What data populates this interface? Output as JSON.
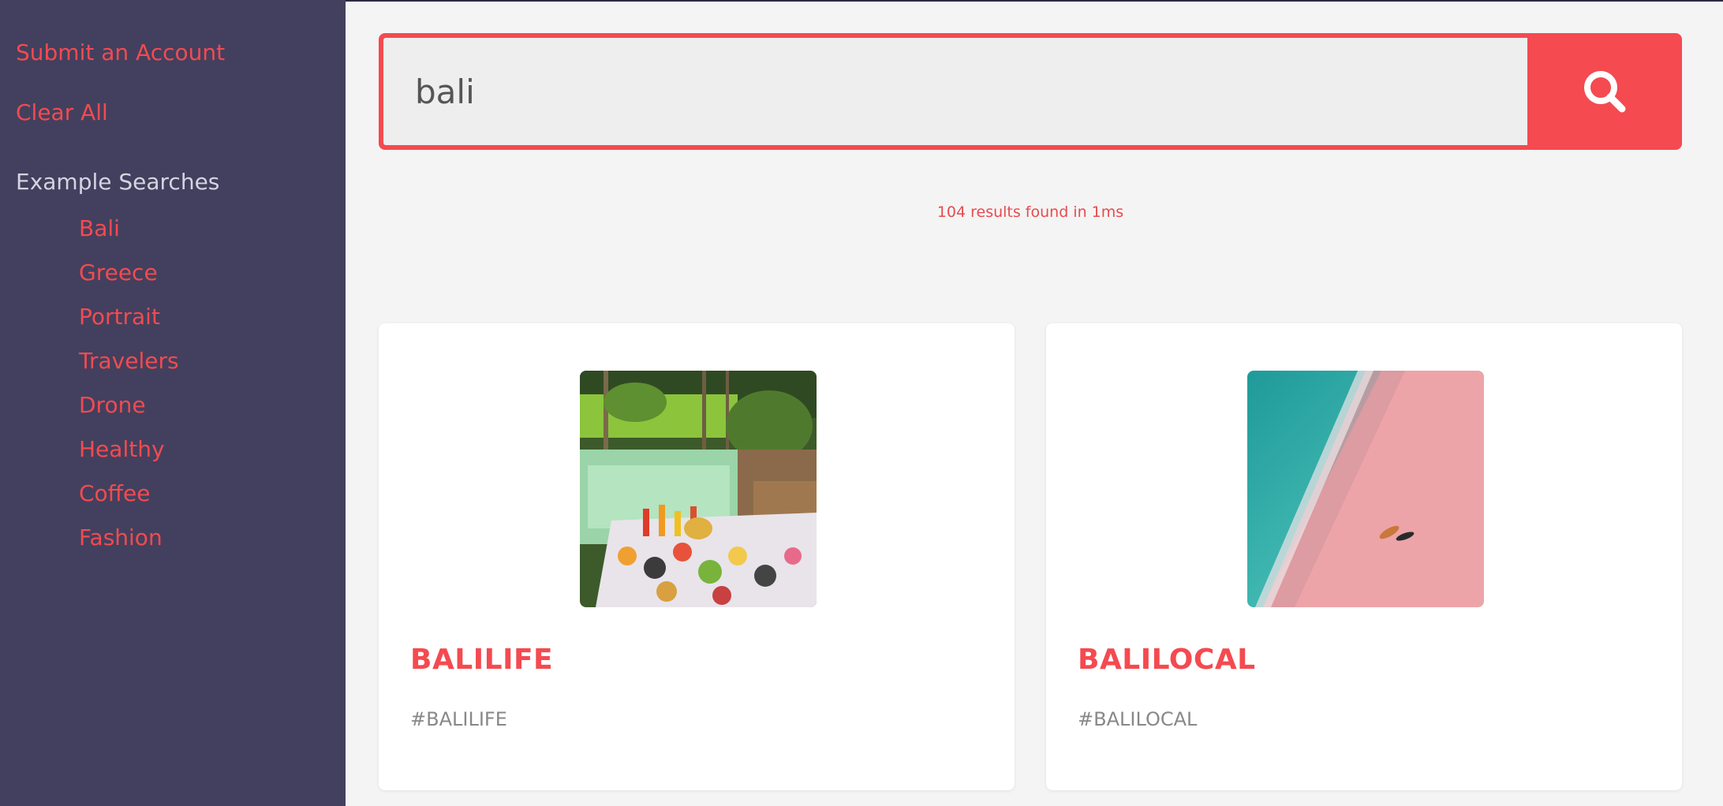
{
  "sidebar": {
    "submit_label": "Submit an Account",
    "clear_label": "Clear All",
    "examples_heading": "Example Searches",
    "examples": [
      "Bali",
      "Greece",
      "Portrait",
      "Travelers",
      "Drone",
      "Healthy",
      "Coffee",
      "Fashion"
    ]
  },
  "search": {
    "value": "bali",
    "button_icon": "search-icon"
  },
  "results": {
    "summary": "104 results found in 1ms"
  },
  "cards": [
    {
      "title": "BALILIFE",
      "tag": "#BALILIFE",
      "image": "pool-breakfast-photo"
    },
    {
      "title": "BALILOCAL",
      "tag": "#BALILOCAL",
      "image": "pink-beach-aerial-photo"
    }
  ],
  "colors": {
    "accent": "#f44a50",
    "sidebar_bg": "#42405e",
    "page_bg": "#f4f4f4",
    "heading": "#d4d4e2"
  }
}
